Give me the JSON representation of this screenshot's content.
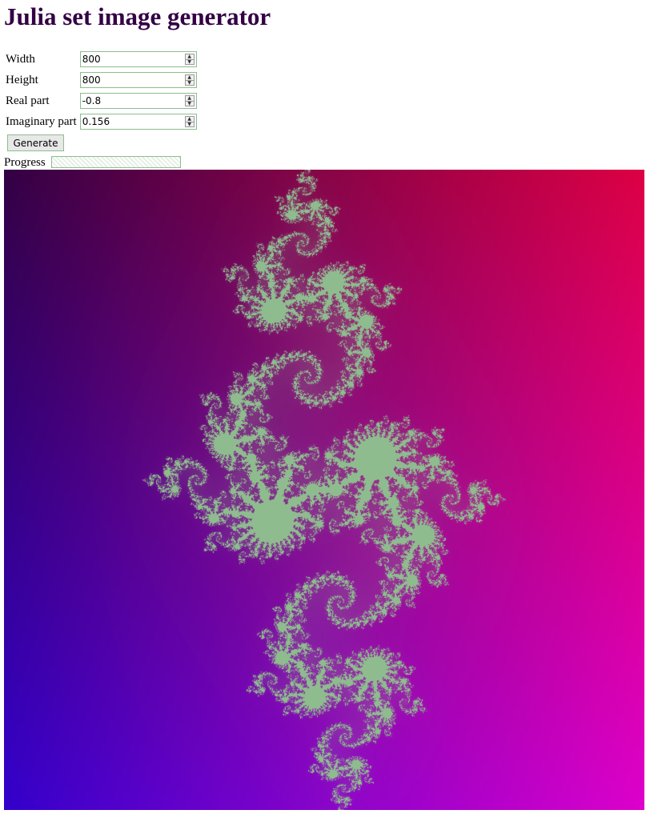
{
  "page": {
    "title": "Julia set image generator"
  },
  "form": {
    "width": {
      "label": "Width",
      "value": "800"
    },
    "height": {
      "label": "Height",
      "value": "800"
    },
    "real_part": {
      "label": "Real part",
      "value": "-0.8"
    },
    "imaginary_part": {
      "label": "Imaginary part",
      "value": "0.156"
    },
    "generate_label": "Generate"
  },
  "progress": {
    "label": "Progress",
    "value": 0
  },
  "image": {
    "c_real": -0.8,
    "c_imag": 0.156,
    "set_color": "#8fbc8f",
    "gradient_colors": [
      "#330044",
      "#dd0044",
      "#3300cc",
      "#dd00cc"
    ]
  }
}
